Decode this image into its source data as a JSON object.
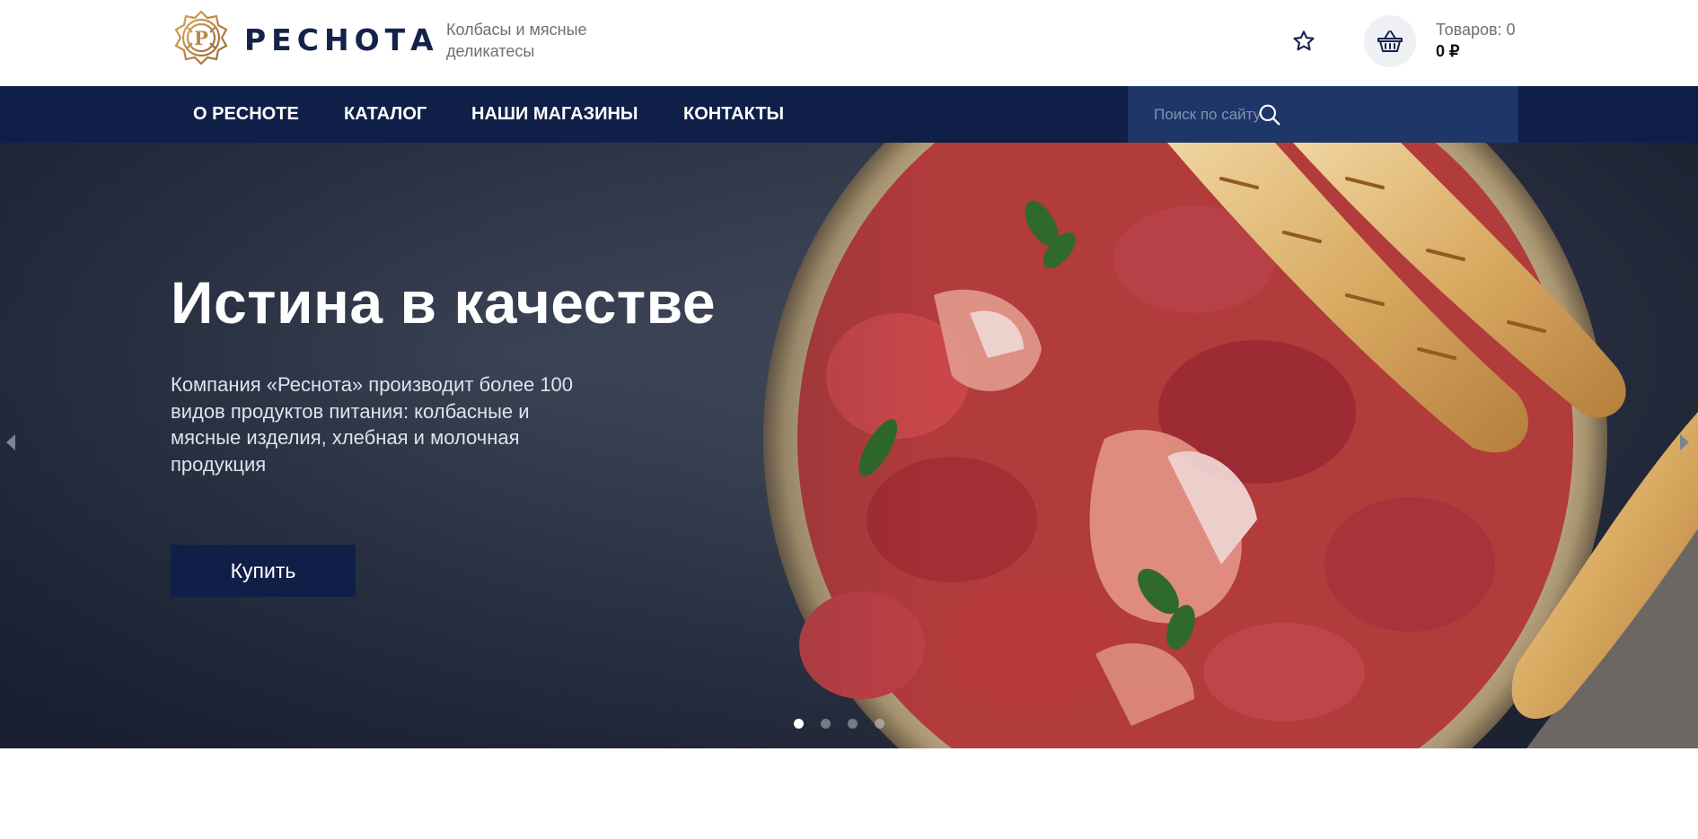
{
  "header": {
    "logo_text": "РЕСНОТА",
    "logo_letter": "Р",
    "tagline": "Колбасы и мясные деликатесы",
    "favorites_icon": "star-outline-icon",
    "cart_icon": "basket-icon",
    "cart_count": "Товаров: 0",
    "cart_total": "0 ₽"
  },
  "nav": {
    "items": [
      {
        "label": "О РЕСНОТЕ"
      },
      {
        "label": "КАТАЛОГ"
      },
      {
        "label": "НАШИ МАГАЗИНЫ"
      },
      {
        "label": "КОНТАКТЫ"
      }
    ],
    "search": {
      "placeholder": "Поиск по сайту",
      "value": "",
      "icon": "search-icon"
    }
  },
  "hero": {
    "title": "Истина в качестве",
    "text": "Компания «Реснота» производит более 100 видов продуктов питания: колбасные и мясные изделия, хлебная и молочная продукция",
    "button_label": "Купить",
    "slides_total": 4,
    "active_slide": 1,
    "prev_icon": "triangle-left-icon",
    "next_icon": "triangle-right-icon"
  },
  "colors": {
    "brand_navy": "#0f1f47",
    "search_bg": "#1f3669",
    "logo_gold": "#b7894a",
    "cart_circle_bg": "#eef0f4"
  }
}
